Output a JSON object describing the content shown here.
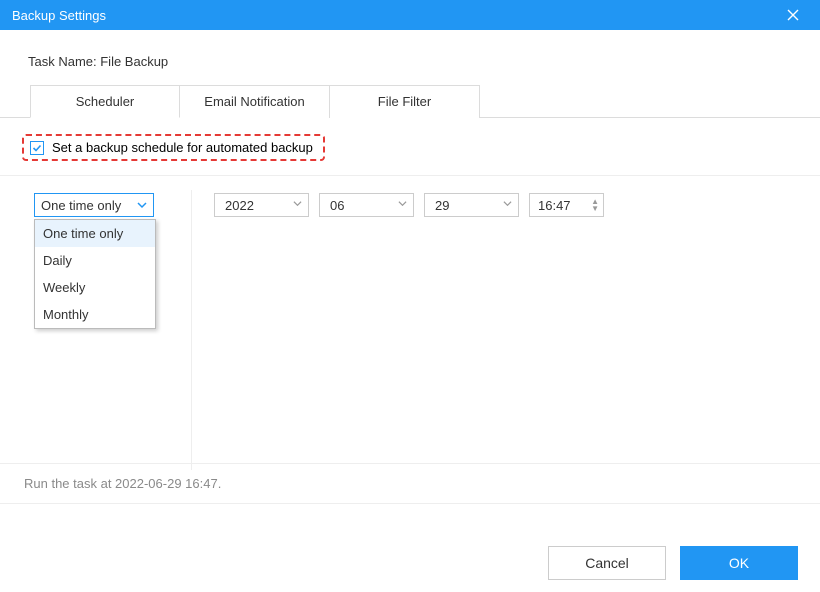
{
  "window": {
    "title": "Backup Settings"
  },
  "task": {
    "label": "Task Name: File Backup"
  },
  "tabs": {
    "scheduler": "Scheduler",
    "email": "Email Notification",
    "filter": "File Filter"
  },
  "schedule": {
    "checkbox_label": "Set a backup schedule for automated backup",
    "checked": true,
    "frequency_selected": "One time only",
    "frequency_options": {
      "one_time": "One time only",
      "daily": "Daily",
      "weekly": "Weekly",
      "monthly": "Monthly"
    },
    "date": {
      "year": "2022",
      "month": "06",
      "day": "29"
    },
    "time": "16:47"
  },
  "status": "Run the task at 2022-06-29 16:47.",
  "buttons": {
    "cancel": "Cancel",
    "ok": "OK"
  }
}
